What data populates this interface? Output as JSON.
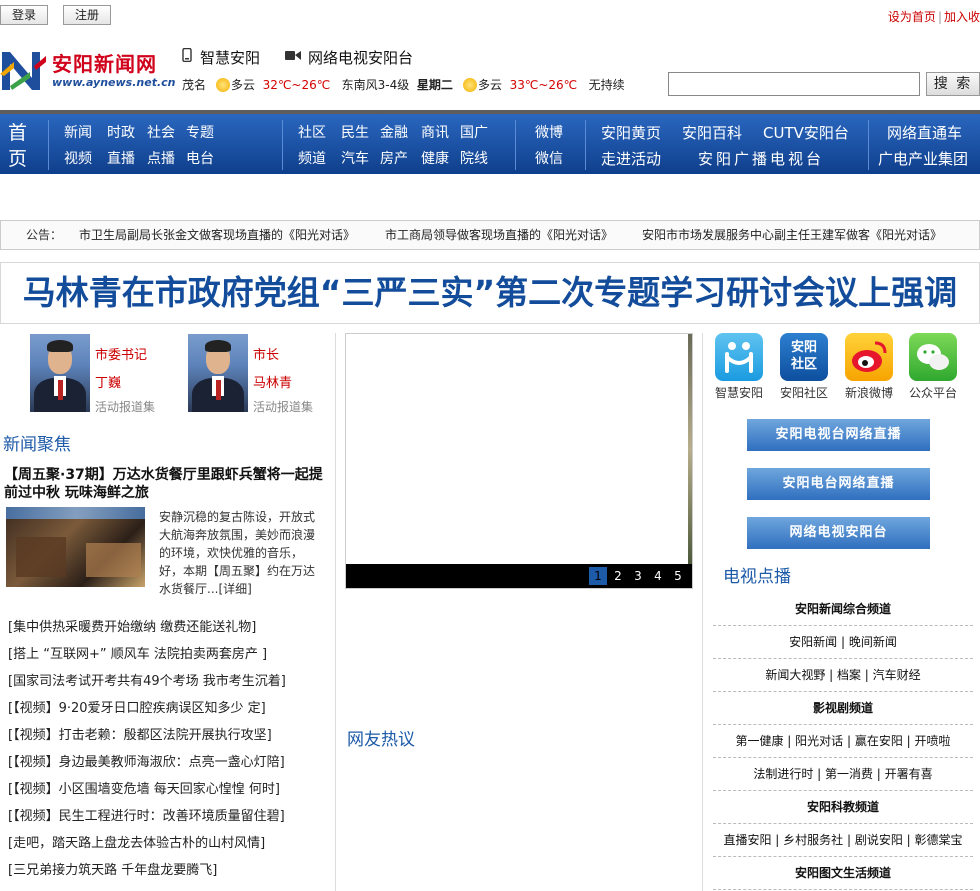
{
  "topbar": {
    "login": "登录",
    "register": "注册",
    "set_home": "设为首页",
    "add_fav": "加入收"
  },
  "logo": {
    "title": "安阳新闻网",
    "url": "www.aynews.net.cn"
  },
  "header": {
    "smart": "智慧安阳",
    "tv": "网络电视安阳台"
  },
  "weather": {
    "city1": "茂名",
    "cond1": "多云",
    "temp1": "32℃~26℃",
    "wind1": "东南风3-4级",
    "weekday": "星期二",
    "cond2": "多云",
    "temp2": "33℃~26℃",
    "wind2": "无持续"
  },
  "search": {
    "button": "搜 索"
  },
  "nav": {
    "home": "首页",
    "row1": [
      "新闻",
      "时政",
      "社会",
      "专题",
      "社区",
      "民生",
      "金融",
      "商讯",
      "国广",
      "微博",
      "安阳黄页",
      "安阳百科",
      "CUTV安阳台",
      "网络直通车"
    ],
    "row2": [
      "视频",
      "直播",
      "点播",
      "电台",
      "频道",
      "汽车",
      "房产",
      "健康",
      "院线",
      "微信",
      "走进活动",
      "安阳广播电视台",
      "广电产业集团"
    ]
  },
  "notice": {
    "label": "公告：",
    "items": [
      "市卫生局副局长张金文做客现场直播的《阳光对话》",
      "市工商局领导做客现场直播的《阳光对话》",
      "安阳市市场发展服务中心副主任王建军做客《阳光对话》"
    ]
  },
  "headline": "马林青在市政府党组“三严三实”第二次专题学习研讨会议上强调",
  "leaders": [
    {
      "title": "市委书记",
      "name": "丁巍",
      "sub": "活动报道集"
    },
    {
      "title": "市长",
      "name": "马林青",
      "sub": "活动报道集"
    }
  ],
  "news_focus": {
    "title": "新闻聚焦",
    "feature_title": "【周五聚·37期】万达水货餐厅里跟虾兵蟹将一起提前过中秋  玩味海鲜之旅",
    "feature_desc": "安静沉稳的复古陈设，开放式大航海奔放氛围，美妙而浪漫的环境，欢快优雅的音乐，好，本期【周五聚】约在万达水货餐厅...",
    "detail": "[详细]",
    "list": [
      "[集中供热采暖费开始缴纳 缴费还能送礼物]",
      "[搭上 “互联网+” 顺风车 法院拍卖两套房产 ]",
      "[国家司法考试开考共有49个考场 我市考生沉着]",
      "[【视频】9·20爱牙日口腔疾病误区知多少 定]",
      "[【视频】打击老赖：殷都区法院开展执行攻坚]",
      "[【视频】身边最美教师海淑欣：点亮一盏心灯陪]",
      "[【视频】小区围墙变危墙 每天回家心惶惶 何时]",
      "[【视频】民生工程进行时：改善环境质量留住碧]",
      "[走吧，踏天路上盘龙去体验古朴的山村风情]",
      "[三兄弟接力筑天路 千年盘龙要腾飞]"
    ]
  },
  "slideshow": {
    "pages": [
      "1",
      "2",
      "3",
      "4",
      "5"
    ],
    "active": 1
  },
  "netizen": {
    "title": "网友热议"
  },
  "apps": [
    {
      "label": "智慧安阳",
      "icon": "smart-anyang-icon"
    },
    {
      "label": "安阳社区",
      "icon": "anyang-community-icon",
      "text": "安阳\n社区"
    },
    {
      "label": "新浪微博",
      "icon": "weibo-icon"
    },
    {
      "label": "公众平台",
      "icon": "wechat-icon"
    }
  ],
  "live_buttons": [
    "安阳电视台网络直播",
    "安阳电台网络直播",
    "网络电视安阳台"
  ],
  "tv_vod": {
    "title": "电视点播",
    "rows": [
      {
        "text": "安阳新闻综合频道",
        "head": true
      },
      {
        "text": "安阳新闻 | 晚间新闻",
        "head": false
      },
      {
        "text": "新闻大视野 | 档案 | 汽车财经",
        "head": false
      },
      {
        "text": "影视剧频道",
        "head": true
      },
      {
        "text": "第一健康 | 阳光对话 | 赢在安阳 | 开喷啦",
        "head": false
      },
      {
        "text": "法制进行时 | 第一消费 | 开署有喜",
        "head": false
      },
      {
        "text": "安阳科教频道",
        "head": true
      },
      {
        "text": "直播安阳 | 乡村服务社 | 剧说安阳 | 彰德棠宝",
        "head": false
      },
      {
        "text": "安阳图文生活频道",
        "head": true
      }
    ]
  },
  "colors": {
    "brand_red": "#d0021b",
    "nav_blue": "#1a4fa0",
    "headline_blue": "#124c9a",
    "link_blue": "#1d5aa8"
  }
}
